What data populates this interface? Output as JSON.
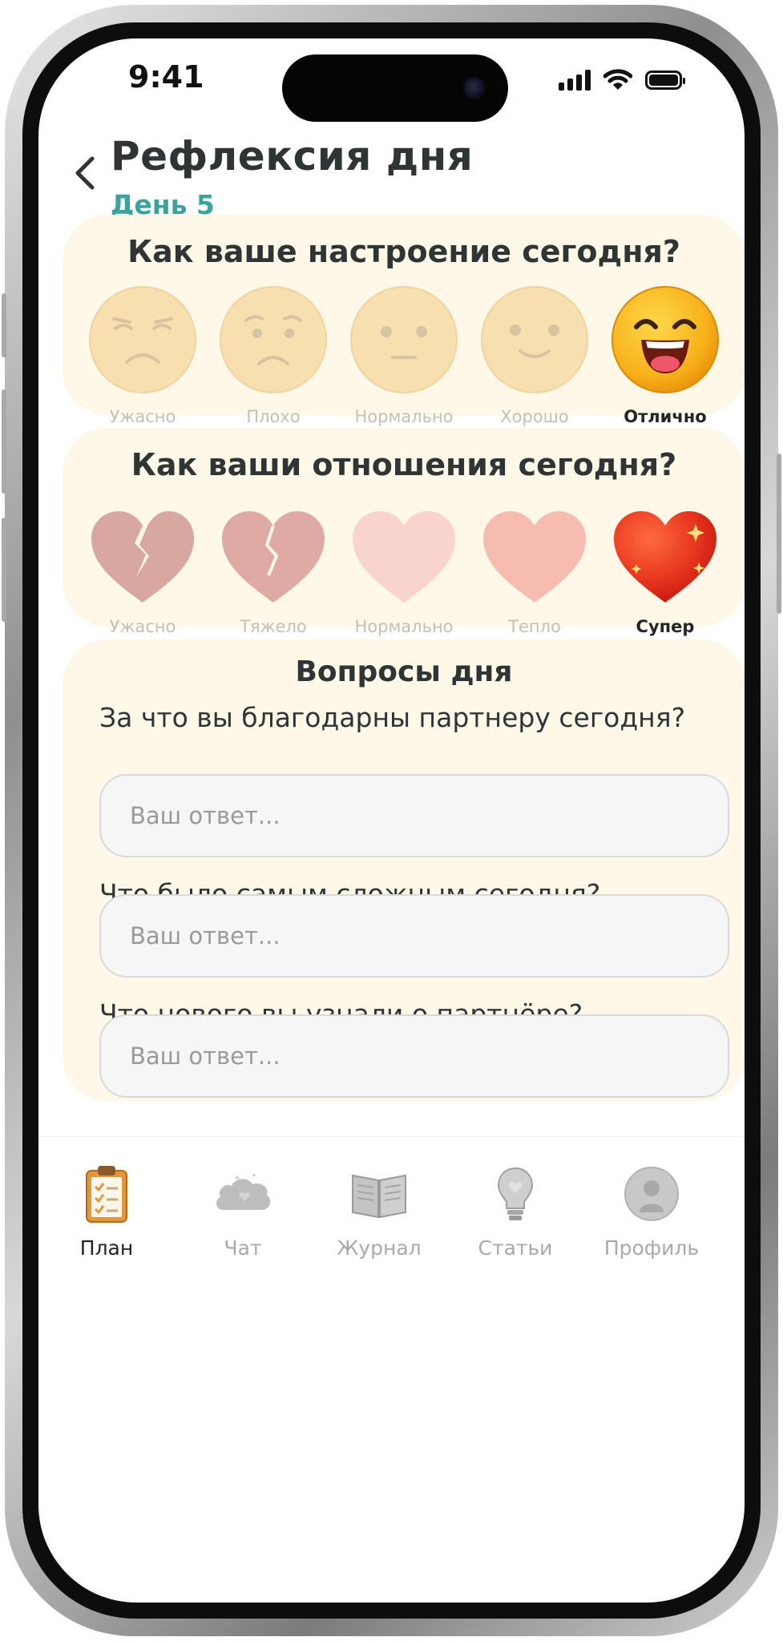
{
  "status_bar": {
    "time": "9:41"
  },
  "header": {
    "title": "Рефлексия дня",
    "subtitle": "День 5"
  },
  "mood": {
    "question": "Как ваше настроение сегодня?",
    "options": [
      "Ужасно",
      "Плохо",
      "Нормально",
      "Хорошо",
      "Отлично"
    ],
    "selected": "Отлично"
  },
  "relationship": {
    "question": "Как ваши отношения сегодня?",
    "options": [
      "Ужасно",
      "Тяжело",
      "Нормально",
      "Тепло",
      "Супер"
    ],
    "selected": "Супер"
  },
  "questions": {
    "title": "Вопросы дня",
    "items": [
      {
        "question": "За что вы благодарны партнеру сегодня?",
        "placeholder": "Ваш ответ..."
      },
      {
        "question": "Что было самым сложным сегодня?",
        "placeholder": "Ваш ответ..."
      },
      {
        "question": "Что нового вы узнали о партнёре?",
        "placeholder": "Ваш ответ..."
      }
    ]
  },
  "tabbar": {
    "items": [
      {
        "label": "План",
        "icon": "clipboard-icon",
        "active": true
      },
      {
        "label": "Чат",
        "icon": "chat-cloud-icon",
        "active": false
      },
      {
        "label": "Журнал",
        "icon": "journal-book-icon",
        "active": false
      },
      {
        "label": "Статьи",
        "icon": "lightbulb-icon",
        "active": false
      },
      {
        "label": "Профиль",
        "icon": "profile-avatar-icon",
        "active": false
      }
    ]
  },
  "colors": {
    "accent": "#3aa39b",
    "card": "#fdf8e7",
    "selected_face": "#f6b11c",
    "selected_heart": "#e8361f"
  }
}
